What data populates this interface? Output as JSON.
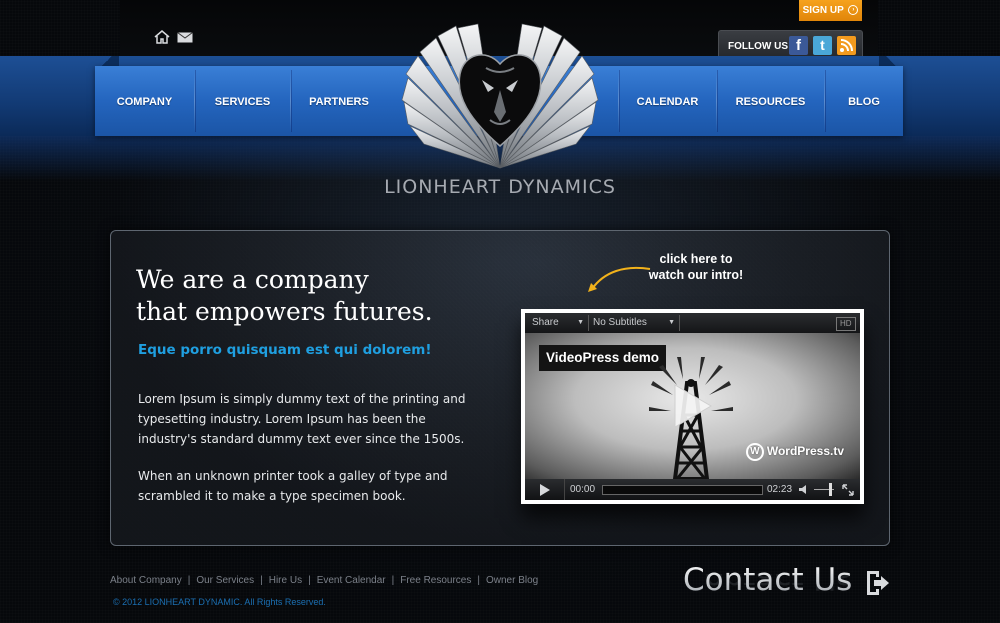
{
  "header": {
    "signup_label": "SIGN UP",
    "follow_label": "FOLLOW US",
    "social": [
      {
        "icon": "facebook-icon",
        "glyph": "f",
        "color": "#3b5998"
      },
      {
        "icon": "twitter-icon",
        "glyph": "t",
        "color": "#4aa7d8"
      },
      {
        "icon": "rss-icon",
        "glyph": "))",
        "color": "#f39a1e"
      }
    ],
    "utility_icons": [
      "home-icon",
      "mail-icon"
    ]
  },
  "nav": {
    "items": [
      "COMPANY",
      "SERVICES",
      "PARTNERS",
      "CALENDAR",
      "RESOURCES",
      "BLOG"
    ]
  },
  "brand": {
    "name": "LIONHEART DYNAMICS"
  },
  "hero": {
    "headline_line1": "We are a company",
    "headline_line2": "that empowers futures.",
    "subhead": "Eque porro quisquam est qui dolorem!",
    "para1": "Lorem Ipsum is simply dummy text of the printing and typesetting industry. Lorem Ipsum has been the industry's standard dummy text ever since the 1500s.",
    "para2": "When an unknown printer took a galley of type and scrambled it to make a type specimen book.",
    "callout": "click here to watch our intro!"
  },
  "video": {
    "share_label": "Share",
    "subtitles_label": "No Subtitles",
    "hd_label": "HD",
    "title": "VideoPress demo",
    "watermark": "WordPress.tv",
    "current_time": "00:00",
    "duration": "02:23",
    "progress": 0
  },
  "footer": {
    "links": [
      "About Company",
      "Our Services",
      "Hire Us",
      "Event Calendar",
      "Free Resources",
      "Owner Blog"
    ],
    "copyright": "© 2012 LIONHEART DYNAMIC. All Rights Reserved.",
    "contact_label": "Contact Us"
  },
  "colors": {
    "accent_blue": "#1f9fe0",
    "nav_blue": "#2465be",
    "signup_orange": "#f39a1e"
  }
}
